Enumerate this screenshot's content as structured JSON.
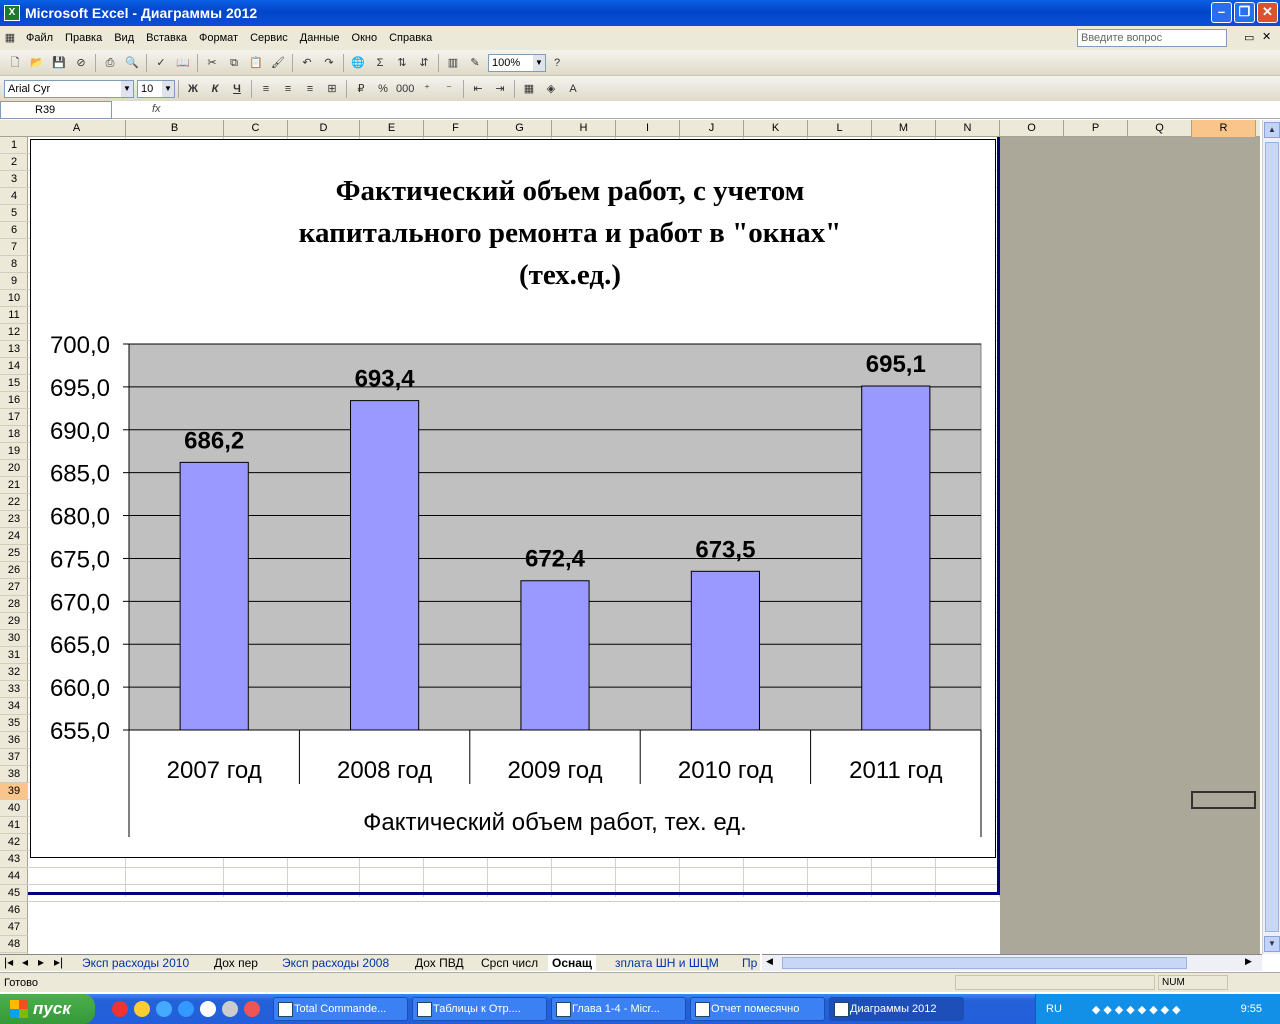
{
  "window": {
    "title": "Microsoft Excel - Диаграммы 2012"
  },
  "menu": {
    "items": [
      "Файл",
      "Правка",
      "Вид",
      "Вставка",
      "Формат",
      "Сервис",
      "Данные",
      "Окно",
      "Справка"
    ],
    "ask_placeholder": "Введите вопрос"
  },
  "toolbar": {
    "zoom": "100%",
    "font": "Arial Cyr",
    "size": "10",
    "bold": "Ж",
    "italic": "К",
    "underline": "Ч"
  },
  "formula_bar": {
    "name_box": "R39",
    "fx": "fx"
  },
  "columns": [
    "A",
    "B",
    "C",
    "D",
    "E",
    "F",
    "G",
    "H",
    "I",
    "J",
    "K",
    "L",
    "M",
    "N",
    "O",
    "P",
    "Q",
    "R"
  ],
  "rows": [
    "1",
    "2",
    "3",
    "4",
    "5",
    "6",
    "7",
    "8",
    "9",
    "10",
    "11",
    "12",
    "13",
    "14",
    "15",
    "16",
    "17",
    "18",
    "19",
    "20",
    "21",
    "22",
    "23",
    "24",
    "25",
    "26",
    "27",
    "28",
    "29",
    "30",
    "31",
    "32",
    "33",
    "34",
    "35",
    "36",
    "37",
    "38",
    "39",
    "40",
    "41",
    "42",
    "43",
    "44",
    "45",
    "46",
    "47",
    "48"
  ],
  "chart_data": {
    "type": "bar",
    "title": "Фактический объем работ, с учетом капитального ремонта и работ в \"окнах\" (тех.ед.)",
    "title_lines": [
      "Фактический объем работ, с учетом",
      "капитального ремонта и работ в \"окнах\"",
      "(тех.ед.)"
    ],
    "categories": [
      "2007 год",
      "2008 год",
      "2009 год",
      "2010 год",
      "2011 год"
    ],
    "values": [
      686.2,
      693.4,
      672.4,
      673.5,
      695.1
    ],
    "value_labels": [
      "686,2",
      "693,4",
      "672,4",
      "673,5",
      "695,1"
    ],
    "xlabel": "Фактический объем работ, тех. ед.",
    "ylabel": "",
    "ylim": [
      655,
      700
    ],
    "yticks": [
      "700,0",
      "695,0",
      "690,0",
      "685,0",
      "680,0",
      "675,0",
      "670,0",
      "665,0",
      "660,0",
      "655,0"
    ],
    "grid": true,
    "colors": {
      "bar": "#9999ff",
      "plot_bg": "#c0c0c0"
    }
  },
  "sheet_tabs": [
    "Эксп расходы 2010",
    "Дох пер",
    "Эксп расходы 2008",
    "Дох ПВД",
    "Срсп числ",
    "Оснащ",
    "зплата ШН и ШЦМ",
    "Пр"
  ],
  "active_tab": "Оснащ",
  "status": {
    "left": "Готово",
    "num": "NUM"
  },
  "taskbar": {
    "start": "пуск",
    "tasks": [
      "Total Commande...",
      "Таблицы к Отр....",
      "Глава 1-4 - Micr...",
      "Отчет помесячно",
      "Диаграммы 2012"
    ],
    "lang": "RU",
    "clock": "9:55"
  }
}
